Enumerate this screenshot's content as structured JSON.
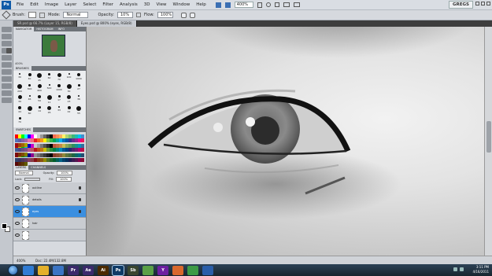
{
  "menubar": {
    "logo": "Ps",
    "items": [
      "File",
      "Edit",
      "Image",
      "Layer",
      "Select",
      "Filter",
      "Analysis",
      "3D",
      "View",
      "Window",
      "Help"
    ],
    "zoom": "400%",
    "workspace": "GREGS"
  },
  "options": {
    "brush_label": "Brush:",
    "mode_label": "Mode:",
    "mode_value": "Normal",
    "opacity_label": "Opacity:",
    "opacity_value": "10%",
    "flow_label": "Flow:",
    "flow_value": "100%"
  },
  "tabs": [
    "SR.psd @ 66.7% (Layer 15, RGB/8)",
    "Eyes.psd @ 800% (eyes, RGB/8)"
  ],
  "panels": {
    "navigator": {
      "tabs": [
        "NAVIGATOR",
        "HISTOGRAM",
        "INFO"
      ],
      "zoom": "400%"
    },
    "brushes": {
      "tab": "BRUSHES",
      "numbers": [
        "30",
        "40",
        "45",
        "60",
        "70",
        "100",
        "1000",
        "200",
        "300",
        "400",
        "500",
        "1000",
        "30",
        "27",
        "39",
        "46",
        "59",
        "11",
        "17",
        "23",
        "36",
        "44",
        "60",
        "14",
        "26",
        "33",
        "42",
        "55",
        "70"
      ]
    },
    "swatches": {
      "tab": "SWATCHES"
    },
    "layers": {
      "tabs": [
        "LAYERS",
        "CHANNELS"
      ],
      "blend_mode": "Normal",
      "opacity_label": "Opacity:",
      "opacity_value": "100%",
      "lock_label": "Lock:",
      "fill_label": "Fill:",
      "fill_value": "100%",
      "rows": [
        {
          "name": "outline",
          "selected": false
        },
        {
          "name": "details",
          "selected": false
        },
        {
          "name": "eyes",
          "selected": true
        },
        {
          "name": "hair",
          "selected": false
        },
        {
          "name": "",
          "selected": false
        }
      ]
    }
  },
  "status": {
    "zoom": "400%",
    "doc": "Doc: 22.4M/132.8M"
  },
  "taskbar": {
    "apps": [
      {
        "name": "ie-icon",
        "label": "",
        "color": "#2f7bd3"
      },
      {
        "name": "explorer-icon",
        "label": "",
        "color": "#e3b02b"
      },
      {
        "name": "media-icon",
        "label": "",
        "color": "#3a74c4"
      },
      {
        "name": "premiere-icon",
        "label": "Pr",
        "color": "#3b2a6b"
      },
      {
        "name": "aftereffects-icon",
        "label": "Ae",
        "color": "#3b2a6b"
      },
      {
        "name": "illustrator-icon",
        "label": "Ai",
        "color": "#4a2a00"
      },
      {
        "name": "photoshop-icon",
        "label": "Ps",
        "color": "#0f3a66"
      },
      {
        "name": "soundbooth-icon",
        "label": "Sb",
        "color": "#3a4630"
      },
      {
        "name": "app-icon",
        "label": "",
        "color": "#5aa046"
      },
      {
        "name": "yahoo-icon",
        "label": "Y",
        "color": "#6d1fa0"
      },
      {
        "name": "firefox-icon",
        "label": "",
        "color": "#d9682c"
      },
      {
        "name": "chrome-icon",
        "label": "",
        "color": "#3d9a45"
      },
      {
        "name": "wmp-icon",
        "label": "",
        "color": "#2a5ea9"
      }
    ],
    "time": "3:11 PM",
    "date": "4/16/2011"
  }
}
